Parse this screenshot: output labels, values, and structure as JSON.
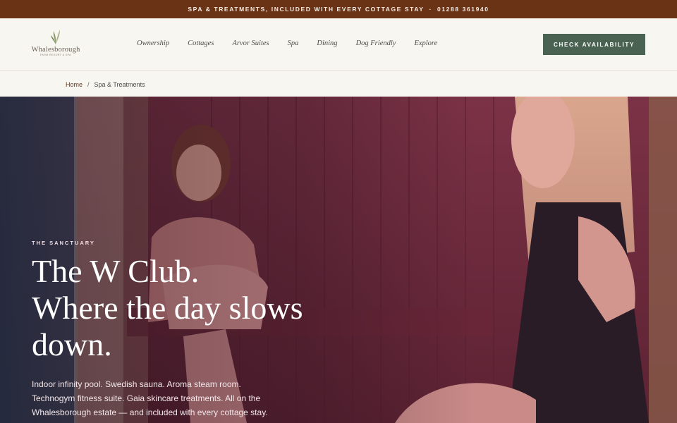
{
  "topbar": {
    "text": "SPA & TREATMENTS, INCLUDED WITH EVERY COTTAGE STAY",
    "separator": "·",
    "phone": "01288 361940",
    "bg_color": "#6b3316"
  },
  "header": {
    "logo": {
      "name": "Whalesborough",
      "tagline": "Farm Resort & Spa",
      "icon": "leaf-icon"
    },
    "nav": [
      "Ownership",
      "Cottages",
      "Arvor Suites",
      "Spa",
      "Dining",
      "Dog Friendly",
      "Explore"
    ],
    "cta_label": "CHECK AVAILABILITY",
    "cta_color": "#4a6252"
  },
  "breadcrumb": {
    "home": "Home",
    "separator": "/",
    "current": "Spa & Treatments"
  },
  "hero": {
    "eyebrow": "THE SANCTUARY",
    "headline": [
      "The W Club.",
      "Where the day slows",
      "down."
    ],
    "intro": "Indoor infinity pool. Swedish sauna. Aroma steam room. Technogym fitness suite. Gaia skincare treatments. All on the Whalesborough estate — and included with every cottage stay.",
    "image_subject": "sauna-photo"
  }
}
